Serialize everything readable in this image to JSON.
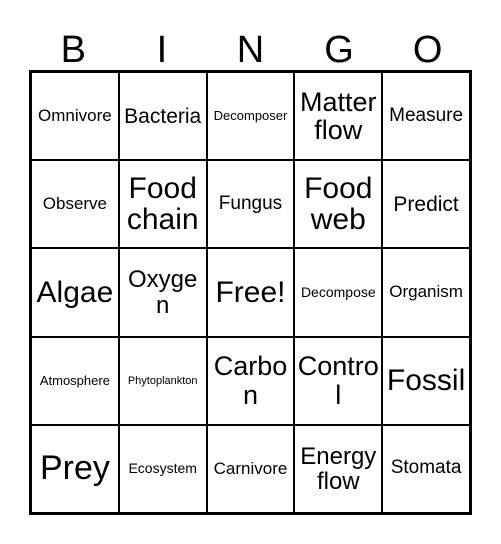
{
  "card": {
    "title": "Bingo Card",
    "background_color": "#ffffff",
    "line_color": "#000000",
    "text_color": "#000000",
    "columns": 5,
    "rows": 5
  },
  "header": {
    "letters": [
      {
        "label": "B"
      },
      {
        "label": "I"
      },
      {
        "label": "N"
      },
      {
        "label": "G"
      },
      {
        "label": "O"
      }
    ]
  },
  "grid": {
    "rows": [
      {
        "cells": [
          {
            "label": "Omnivore",
            "size": "fs-m",
            "free": false
          },
          {
            "label": "Bacteria",
            "size": "fs-l",
            "free": false
          },
          {
            "label": "Decomposer",
            "size": "fs-xs",
            "free": false
          },
          {
            "label": "Matter flow",
            "size": "fs-xxl",
            "free": false
          },
          {
            "label": "Measure",
            "size": "fs-ml",
            "free": false
          }
        ]
      },
      {
        "cells": [
          {
            "label": "Observe",
            "size": "fs-m",
            "free": false
          },
          {
            "label": "Food chain",
            "size": "fs-3xl",
            "free": false
          },
          {
            "label": "Fungus",
            "size": "fs-ml",
            "free": false
          },
          {
            "label": "Food web",
            "size": "fs-3xl",
            "free": false
          },
          {
            "label": "Predict",
            "size": "fs-l",
            "free": false
          }
        ]
      },
      {
        "cells": [
          {
            "label": "Algae",
            "size": "fs-3xl",
            "free": false
          },
          {
            "label": "Oxygen",
            "size": "fs-xl",
            "free": false
          },
          {
            "label": "Free!",
            "size": "fs-3xl",
            "free": true
          },
          {
            "label": "Decompose",
            "size": "fs-s",
            "free": false
          },
          {
            "label": "Organism",
            "size": "fs-m",
            "free": false
          }
        ]
      },
      {
        "cells": [
          {
            "label": "Atmosphere",
            "size": "fs-xs",
            "free": false
          },
          {
            "label": "Phytoplankton",
            "size": "fs-xxs",
            "free": false
          },
          {
            "label": "Carbon",
            "size": "fs-xxl",
            "free": false
          },
          {
            "label": "Control",
            "size": "fs-xxl",
            "free": false
          },
          {
            "label": "Fossil",
            "size": "fs-3xl",
            "free": false
          }
        ]
      },
      {
        "cells": [
          {
            "label": "Prey",
            "size": "fs-4xl",
            "free": false
          },
          {
            "label": "Ecosystem",
            "size": "fs-s",
            "free": false
          },
          {
            "label": "Carnivore",
            "size": "fs-m",
            "free": false
          },
          {
            "label": "Energy flow",
            "size": "fs-xl",
            "free": false
          },
          {
            "label": "Stomata",
            "size": "fs-ml",
            "free": false
          }
        ]
      }
    ]
  }
}
